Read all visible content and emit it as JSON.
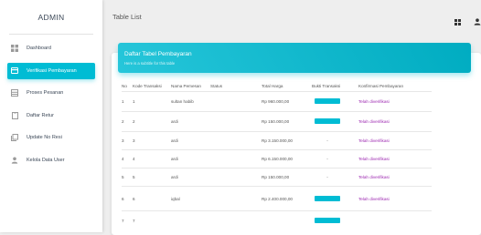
{
  "sidebar": {
    "brand": "ADMIN",
    "items": [
      {
        "label": "Dashboard",
        "icon": "dashboard-icon",
        "active": false
      },
      {
        "label": "Verifikasi Pembayaran",
        "icon": "credit-card-icon",
        "active": true
      },
      {
        "label": "Proses Pesanan",
        "icon": "receipt-icon",
        "active": false
      },
      {
        "label": "Daftar Retur",
        "icon": "document-icon",
        "active": false
      },
      {
        "label": "Update No Resi",
        "icon": "library-icon",
        "active": false
      },
      {
        "label": "Kelola Data User",
        "icon": "person-icon",
        "active": false
      }
    ]
  },
  "topbar": {
    "title": "Table List",
    "icons": [
      "grid-icon",
      "person-icon"
    ]
  },
  "card": {
    "title": "Daftar Tabel Pembayaran",
    "subtitle": "Here is a subtitle for this table"
  },
  "table": {
    "headers": [
      "No",
      "Kode Transaksi",
      "Nama Pemesan",
      "Status",
      "Total Harga",
      "Bukti Transaksi",
      "Konfirmasi Pembayaran"
    ],
    "rows": [
      {
        "no": "1",
        "kode": "1",
        "nama": "sultan habib",
        "status": "",
        "total": "Rp 960.000,00",
        "bukti": "button",
        "konfirmasi": "Telah diverifikasi"
      },
      {
        "no": "2",
        "kode": "2",
        "nama": "ardi",
        "status": "",
        "total": "Rp 150.000,00",
        "bukti": "button",
        "konfirmasi": "Telah diverifikasi"
      },
      {
        "no": "3",
        "kode": "3",
        "nama": "ardi",
        "status": "",
        "total": "Rp 3.150.000,00",
        "bukti": "-",
        "konfirmasi": "Telah diverifikasi"
      },
      {
        "no": "4",
        "kode": "4",
        "nama": "ardi",
        "status": "",
        "total": "Rp 6.150.000,00",
        "bukti": "-",
        "konfirmasi": "Telah diverifikasi"
      },
      {
        "no": "5",
        "kode": "5",
        "nama": "ardi",
        "status": "",
        "total": "Rp 150.000,00",
        "bukti": "-",
        "konfirmasi": "Telah diverifikasi"
      },
      {
        "no": "6",
        "kode": "6",
        "nama": "iqbal",
        "status": "",
        "total": "Rp 2.400.000,00",
        "bukti": "button",
        "konfirmasi": "Telah diverifikasi"
      },
      {
        "no": "7",
        "kode": "7",
        "nama": "",
        "status": "",
        "total": "",
        "bukti": "button",
        "konfirmasi": ""
      }
    ],
    "bukti_button_label": "",
    "colors": {
      "accent": "#00bcd4",
      "confirm": "#9c27b0"
    }
  }
}
